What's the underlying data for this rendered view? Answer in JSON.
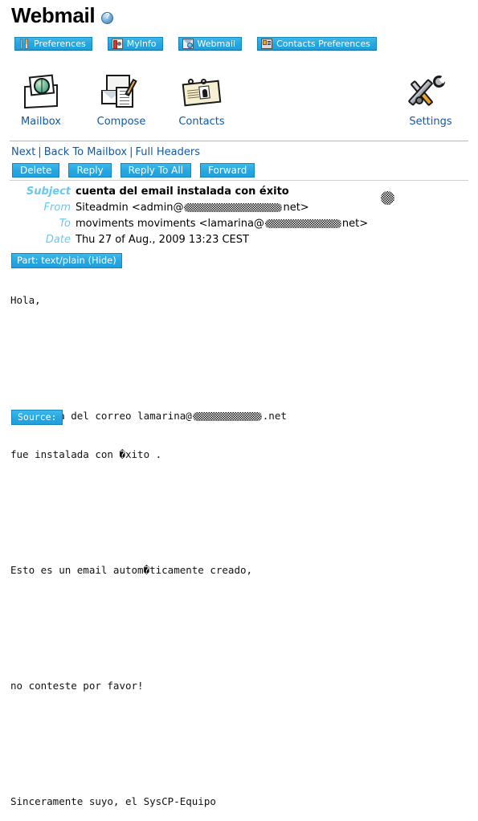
{
  "page": {
    "title": "Webmail",
    "help_icon": "help-circle-icon"
  },
  "navbar": {
    "items": [
      {
        "label": "Preferences",
        "icon": "tools-icon"
      },
      {
        "label": "MyInfo",
        "icon": "id-card-icon"
      },
      {
        "label": "Webmail",
        "icon": "envelope-globe-icon"
      },
      {
        "label": "Contacts Preferences",
        "icon": "contact-card-icon"
      }
    ]
  },
  "toolbar": {
    "items": [
      {
        "label": "Mailbox",
        "icon": "mailbox-envelope-icon"
      },
      {
        "label": "Compose",
        "icon": "compose-pencil-icon"
      },
      {
        "label": "Contacts",
        "icon": "contacts-card-icon"
      }
    ],
    "settings": {
      "label": "Settings",
      "icon": "wrench-screwdriver-icon"
    }
  },
  "linkbar": {
    "next": "Next",
    "back_to_mailbox": "Back To Mailbox",
    "full_headers": "Full Headers",
    "separator": "|"
  },
  "actions": [
    {
      "label": "Delete"
    },
    {
      "label": "Reply"
    },
    {
      "label": "Reply To All"
    },
    {
      "label": "Forward"
    }
  ],
  "message": {
    "headers": [
      {
        "label": "Subject",
        "value": "cuenta del email instalada con éxito",
        "redacted": false
      },
      {
        "label": "From",
        "value_before": "Siteadmin <admin@",
        "redacted": true,
        "redact_width": 122,
        "value_after": "net>"
      },
      {
        "label": "To",
        "value_before": "moviments moviments <lamarina@",
        "redacted": true,
        "redact_width": 95,
        "value_after": "net>"
      },
      {
        "label": "Date",
        "value": "Thu 27 of Aug., 2009 13:23 CEST",
        "redacted": false
      }
    ],
    "part_badge": "Part: text/plain (Hide)",
    "body": {
      "line_1": "Hola,",
      "line_2_before": "su cuenta del correo lamarina@",
      "line_2_redact_width": 86,
      "line_2_after": ".net",
      "line_3": "fue instalada con �xito .",
      "line_4": "Esto es un email autom�ticamente creado,",
      "line_5": "no conteste por favor!",
      "line_6": "Sinceramente suyo, el SysCP-Equipo"
    },
    "source_badge": "Source:"
  },
  "colors": {
    "accent": "#27a6e0",
    "link": "#1358a8",
    "header_label": "#68c8f0",
    "rule": "#b9b9b9"
  }
}
